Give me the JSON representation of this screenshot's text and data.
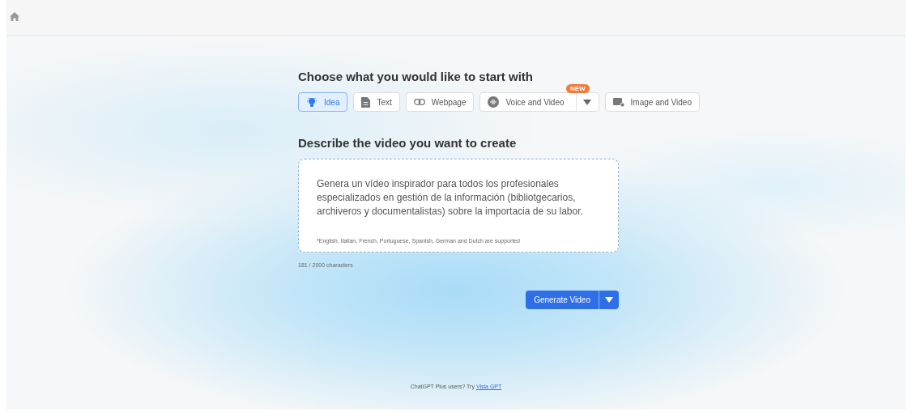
{
  "heading_start": "Choose what you would like to start with",
  "tabs": [
    {
      "label": "Idea",
      "kind": "idea",
      "selected": true
    },
    {
      "label": "Text",
      "kind": "text",
      "selected": false
    },
    {
      "label": "Webpage",
      "kind": "webpage",
      "selected": false
    },
    {
      "label": "Voice and Video",
      "kind": "voice",
      "selected": false,
      "badge": "NEW",
      "dropdown": true
    },
    {
      "label": "Image and Video",
      "kind": "image",
      "selected": false
    }
  ],
  "heading_describe": "Describe the video you want to create",
  "prompt": {
    "value": "Genera un vídeo inspirador para todos los profesionales especializados en gestión de la información (bibliotgecarios, archiveros y documentalistas) sobre la importacia de su labor.",
    "note": "*English, Italian, French, Portuguese, Spanish, German and Dutch are supported"
  },
  "char_count": "181 / 2000 characters",
  "generate_button": "Generate Video",
  "footer": {
    "text": "ChatGPT Plus users? Try ",
    "link": "Visla GPT"
  }
}
